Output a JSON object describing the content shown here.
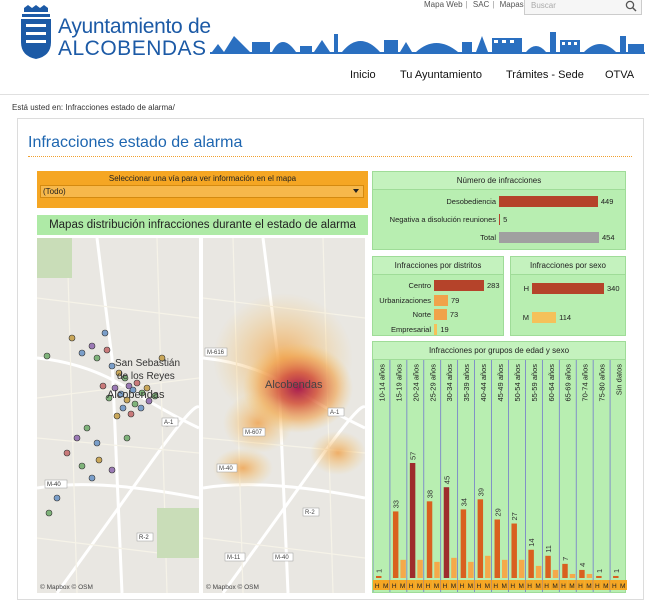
{
  "header": {
    "brand_line1": "Ayuntamiento de",
    "brand_line2": "ALCOBENDAS",
    "toplinks": [
      "Mapa Web",
      "SAC",
      "Mapas"
    ],
    "search_placeholder": "Buscar",
    "nav": [
      "Inicio",
      "Tu Ayuntamiento",
      "Trámites - Sede",
      "OTVA"
    ]
  },
  "breadcrumb": {
    "prefix": "Está usted en:",
    "current": "Infracciones estado de alarma"
  },
  "page_title": "Infracciones estado de alarma",
  "selector": {
    "label": "Seleccionar una vía para ver información en el mapa",
    "value": "(Todo)"
  },
  "maps": {
    "title": "Mapas distribución infracciones durante el estado de alarma",
    "labels": [
      "San Sebastián",
      "de los Reyes",
      "Alcobendas"
    ],
    "heat_label": "Alcobendas",
    "road_labels": [
      "M-616",
      "M-607",
      "M-40",
      "M-11",
      "M-40",
      "A-1",
      "M-40",
      "R-2",
      "M-12"
    ],
    "attribution": "© Mapbox  © OSM"
  },
  "chart_data": [
    {
      "type": "bar",
      "title": "Número de infracciones",
      "categories": [
        "Desobediencia",
        "Negativa a disolución reuniones",
        "Total"
      ],
      "values": [
        449,
        5,
        454
      ],
      "colors": [
        "#b5432a",
        "#b5432a",
        "#a0a0a0"
      ]
    },
    {
      "type": "bar",
      "title": "Infracciones por distritos",
      "categories": [
        "Centro",
        "Urbanizaciones",
        "Norte",
        "Empresarial"
      ],
      "values": [
        283,
        79,
        73,
        19
      ],
      "colors": [
        "#b5432a",
        "#f0a24a",
        "#f0a24a",
        "#f5c15a"
      ]
    },
    {
      "type": "bar",
      "title": "Infracciones por sexo",
      "categories": [
        "H",
        "M"
      ],
      "values": [
        340,
        114
      ],
      "colors": [
        "#b5432a",
        "#f5c15a"
      ]
    },
    {
      "type": "bar",
      "title": "Infracciones por grupos de edad y sexo",
      "categories": [
        "10-14 años",
        "15-19 años",
        "20-24 años",
        "25-29 años",
        "30-34 años",
        "35-39 años",
        "40-44 años",
        "45-49 años",
        "50-54 años",
        "55-59 años",
        "60-64 años",
        "65-69 años",
        "70-74 años",
        "75-80 años",
        "Sin datos"
      ],
      "series": [
        {
          "name": "H",
          "values": [
            1,
            33,
            57,
            38,
            45,
            34,
            39,
            29,
            27,
            14,
            11,
            7,
            4,
            1,
            1
          ]
        },
        {
          "name": "M",
          "values": [
            0,
            9,
            9,
            8,
            10,
            8,
            11,
            9,
            9,
            6,
            4,
            2,
            2,
            0,
            0
          ]
        }
      ]
    }
  ]
}
